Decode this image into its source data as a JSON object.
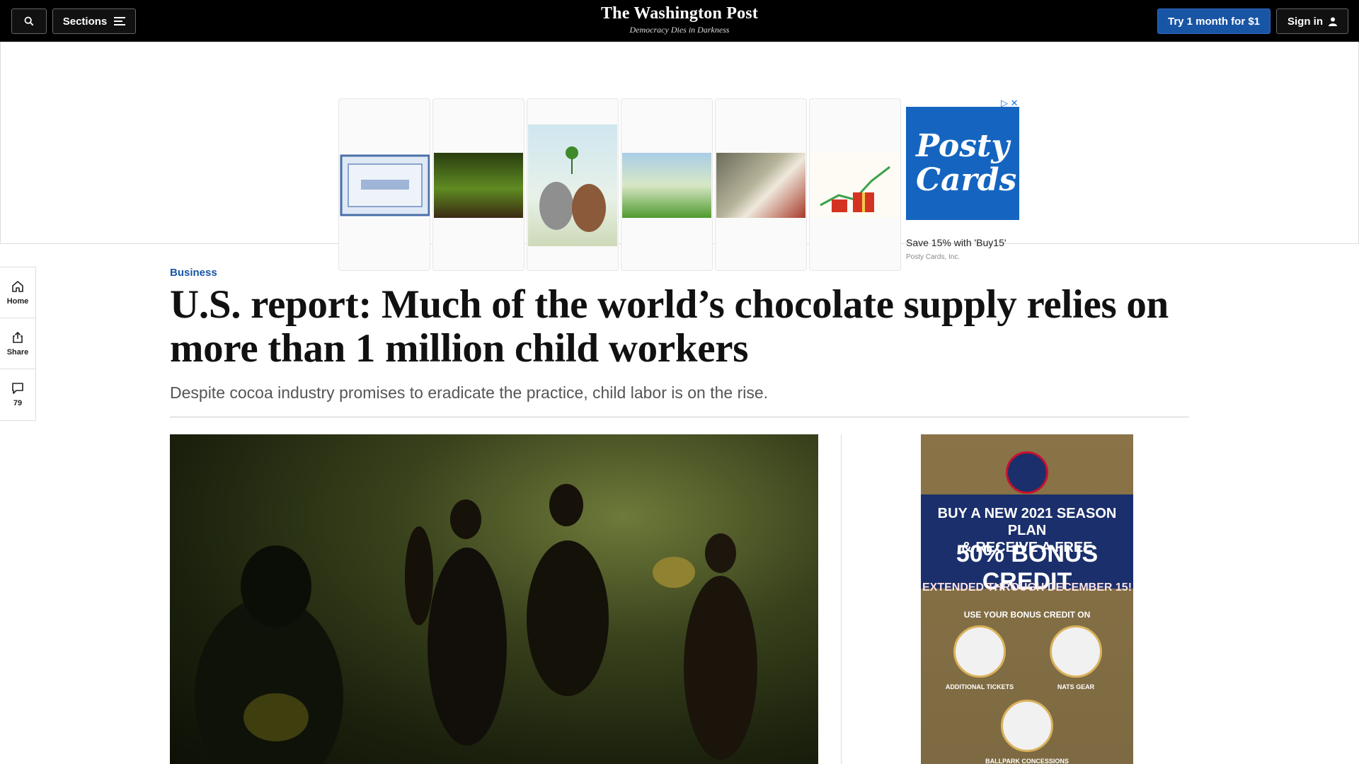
{
  "nav": {
    "sections_label": "Sections",
    "logo": "The Washington Post",
    "tagline": "Democracy Dies in Darkness",
    "trial_label": "Try 1 month for $1",
    "signin_label": "Sign in"
  },
  "top_ad": {
    "caption": "Save 15% with 'Buy15'",
    "advertiser": "Posty Cards, Inc.",
    "brand_line1": "Posty",
    "brand_line2": "Cards"
  },
  "rail": {
    "home_label": "Home",
    "share_label": "Share",
    "comments_count": "79"
  },
  "article": {
    "kicker": "Business",
    "headline": "U.S. report: Much of the world’s chocolate supply relies on more than 1 million child workers",
    "dek": "Despite cocoa industry promises to eradicate the practice, child labor is on the rise."
  },
  "side_ad": {
    "line1": "BUY A NEW 2021 SEASON PLAN",
    "line2": "& RECEIVE A FREE",
    "line3": "50% BONUS CREDIT",
    "line4": "EXTENDED THROUGH DECEMBER 15!",
    "line5": "USE YOUR BONUS CREDIT ON",
    "item1": "ADDITIONAL TICKETS",
    "item2": "NATS GEAR",
    "item3": "BALLPARK CONCESSIONS"
  }
}
